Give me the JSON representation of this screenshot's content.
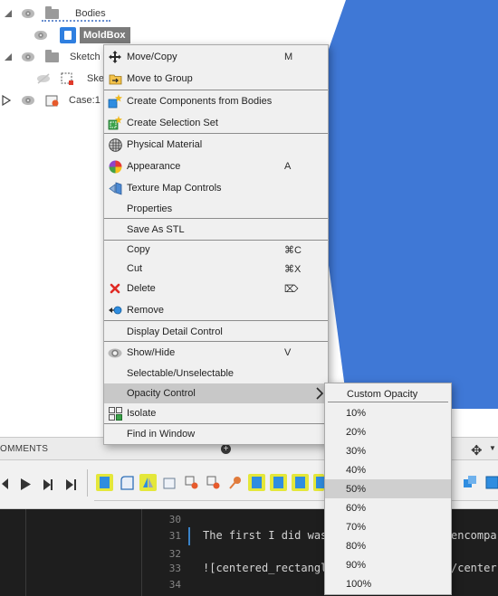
{
  "browser_tree": {
    "bodies_label": "Bodies",
    "moldbox_label": "MoldBox",
    "sketches_label": "Sketch",
    "sketch_item_label": "Ske",
    "case_label": "Case:1"
  },
  "context_menu": {
    "items": [
      {
        "label": "Move/Copy",
        "shortcut": "M",
        "icon": "move-arrows-icon"
      },
      {
        "label": "Move to Group",
        "shortcut": "",
        "icon": "group-folder-icon"
      },
      {
        "label": "Create Components from Bodies",
        "shortcut": "",
        "icon": "components-star-icon"
      },
      {
        "label": "Create Selection Set",
        "shortcut": "",
        "icon": "selection-set-icon"
      },
      {
        "label": "Physical Material",
        "shortcut": "",
        "icon": "material-sphere-icon"
      },
      {
        "label": "Appearance",
        "shortcut": "A",
        "icon": "color-wheel-icon"
      },
      {
        "label": "Texture Map Controls",
        "shortcut": "",
        "icon": "texture-map-icon"
      },
      {
        "label": "Properties",
        "shortcut": ""
      },
      {
        "label": "Save As STL",
        "shortcut": ""
      },
      {
        "label": "Copy",
        "shortcut": "⌘C"
      },
      {
        "label": "Cut",
        "shortcut": "⌘X"
      },
      {
        "label": "Delete",
        "shortcut": "⌦",
        "icon": "red-x-icon"
      },
      {
        "label": "Remove",
        "shortcut": "",
        "icon": "remove-icon"
      },
      {
        "label": "Display Detail Control",
        "shortcut": ""
      },
      {
        "label": "Show/Hide",
        "shortcut": "V",
        "icon": "eye-icon"
      },
      {
        "label": "Selectable/Unselectable",
        "shortcut": ""
      },
      {
        "label": "Opacity Control",
        "shortcut": ""
      },
      {
        "label": "Isolate",
        "shortcut": "",
        "icon": "isolate-icon"
      },
      {
        "label": "Find in Window",
        "shortcut": ""
      }
    ]
  },
  "opacity_submenu": {
    "title": "Custom Opacity",
    "options": [
      "10%",
      "20%",
      "30%",
      "40%",
      "50%",
      "60%",
      "70%",
      "80%",
      "90%",
      "100%"
    ],
    "selected": "50%"
  },
  "comments_panel": {
    "label": "OMMENTS"
  },
  "editor": {
    "line_numbers": [
      "30",
      "31",
      "32",
      "33",
      "34"
    ],
    "line31_text": "The first I did was",
    "line31_tail": "encompa",
    "line33_link": "![centered_rectangl",
    "line33_tail": "/center"
  },
  "colors": {
    "canvas_shape": "#3f78d6",
    "timeline_yellow": "#e4e73a",
    "timeline_blue": "#2f8de0",
    "editor_bg": "#1e1e1e",
    "menu_bg": "#f0f0f0",
    "delete_red": "#e02a24"
  }
}
